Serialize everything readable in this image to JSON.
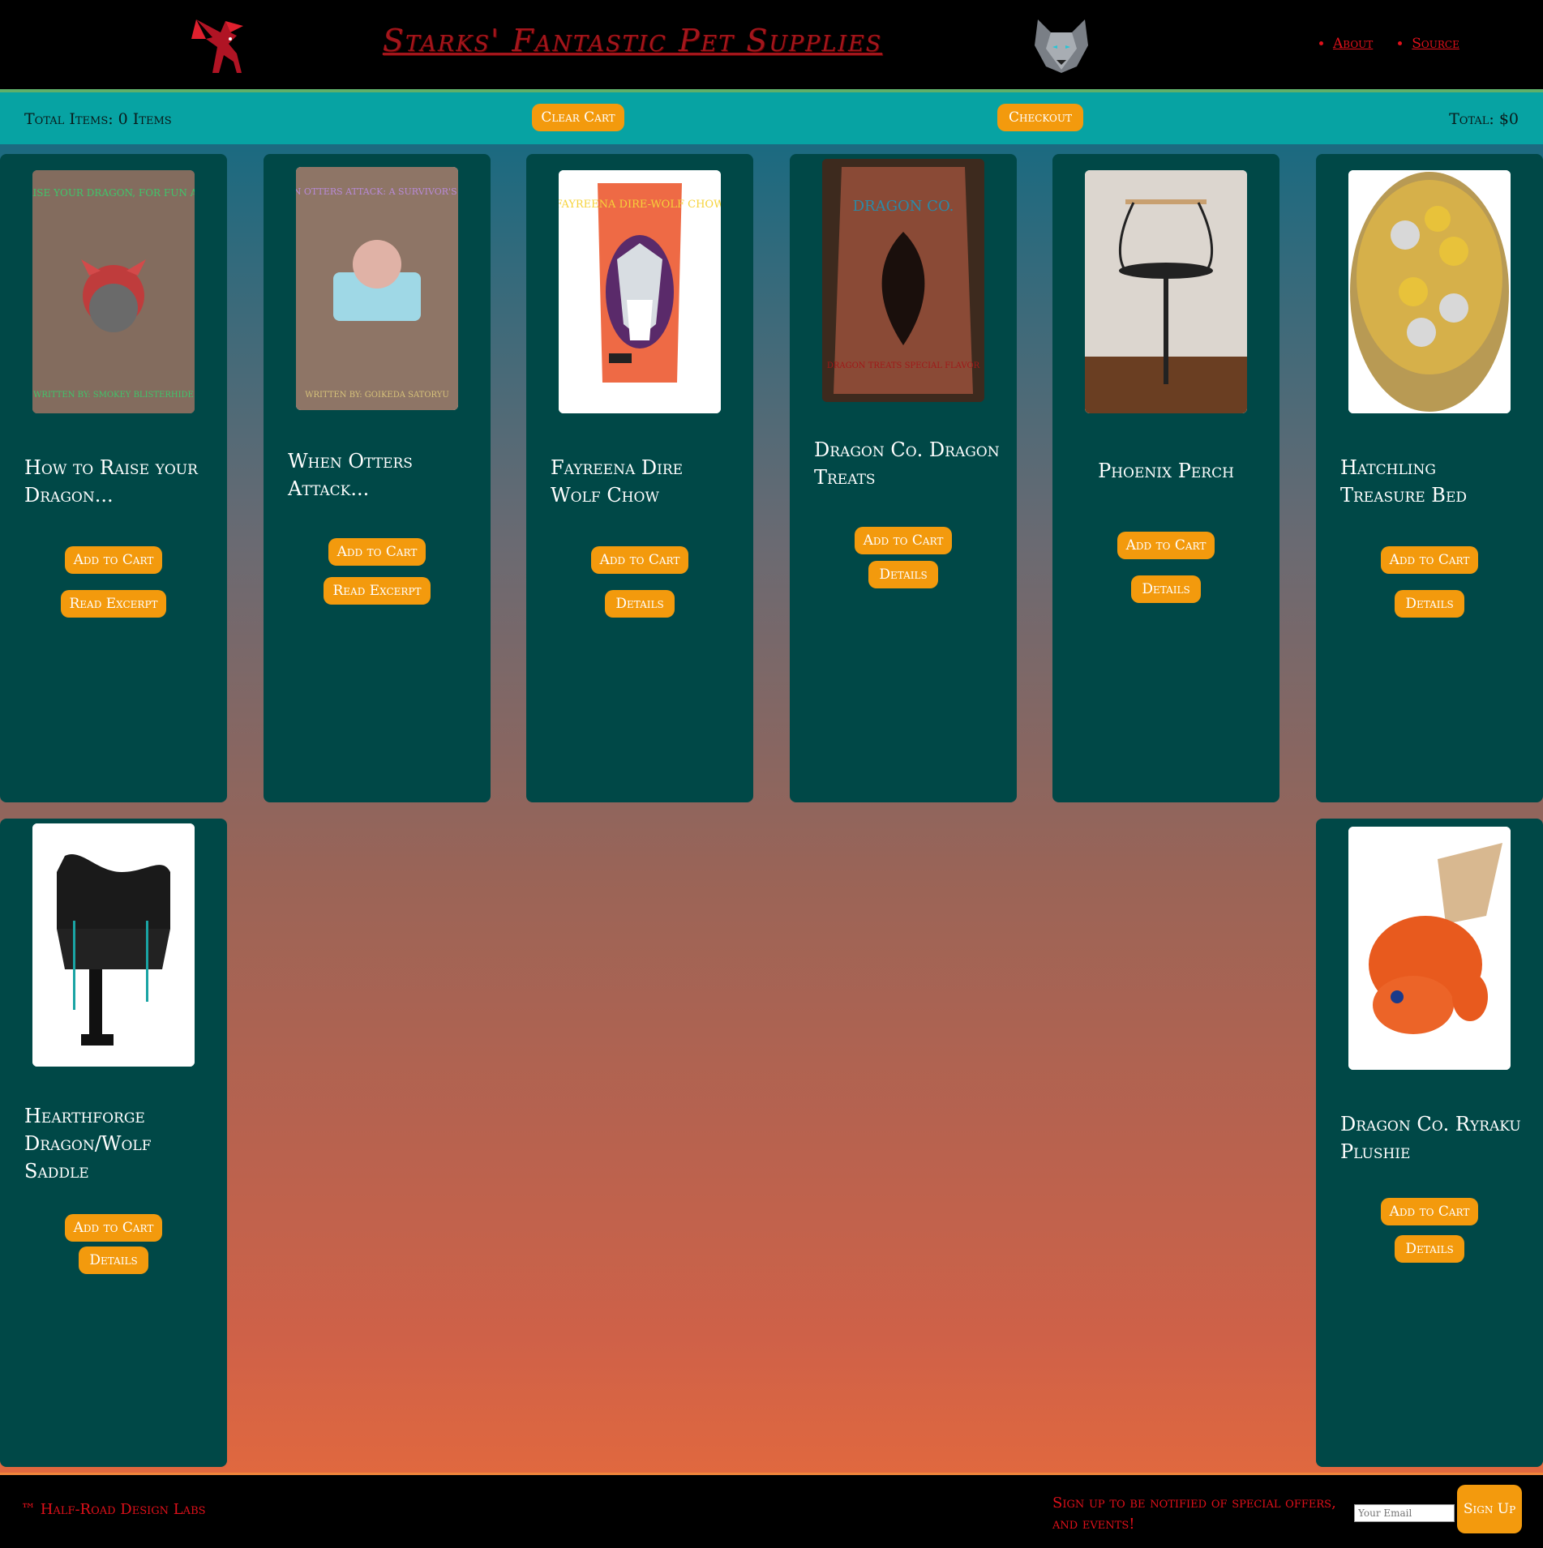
{
  "header": {
    "site_title": "Starks' Fantastic Pet Supplies",
    "nav": [
      {
        "label": "About"
      },
      {
        "label": "Source"
      }
    ]
  },
  "cart": {
    "total_items": "Total Items: 0 Items",
    "clear_label": "Clear Cart",
    "checkout_label": "Checkout",
    "total": "Total: $0"
  },
  "products": [
    {
      "title": "How to Raise your Dragon...",
      "primary": "Add to Cart",
      "secondary": "Read Excerpt",
      "cover_title": "HOW TO RAISE YOUR DRAGON, FOR FUN AND PROFIT",
      "cover_author": "WRITTEN BY: SMOKEY BLISTERHIDE"
    },
    {
      "title": "When Otters Attack...",
      "primary": "Add to Cart",
      "secondary": "Read Excerpt",
      "cover_title": "WHEN OTTERS ATTACK: A SURVIVOR'S TALE",
      "cover_author": "WRITTEN BY: GOIKEDA SATORYU"
    },
    {
      "title": "Fayreena Dire Wolf Chow",
      "primary": "Add to Cart",
      "secondary": "Details",
      "cover_title": "FAYREENA DIRE-WOLF CHOW"
    },
    {
      "title": "Dragon Co. Dragon Treats",
      "primary": "Add to Cart",
      "secondary": "Details",
      "cover_title": "DRAGON CO.",
      "cover_sub": "DRAGON TREATS SPECIAL FLAVOR"
    },
    {
      "title": "Phoenix Perch",
      "primary": "Add to Cart",
      "secondary": "Details"
    },
    {
      "title": "Hatchling Treasure Bed",
      "primary": "Add to Cart",
      "secondary": "Details"
    },
    {
      "title": "Hearthforge Dragon/Wolf Saddle",
      "primary": "Add to Cart",
      "secondary": "Details"
    },
    {
      "title": "Dragon Co. Ryraku Plushie",
      "primary": "Add to Cart",
      "secondary": "Details"
    }
  ],
  "footer": {
    "trademark": "™ Half-Road Design Labs",
    "signup_text": "Sign up to be notified of special offers, and events!",
    "email_placeholder": "Your Email",
    "signup_button": "Sign Up"
  },
  "icons": {
    "left_logo": "dragon-logo-icon",
    "right_logo": "wolf-logo-icon"
  },
  "colors": {
    "accent": "#f39a0d",
    "title_red": "#a3161c",
    "card_bg": "#004847",
    "cart_bar": "#07a3a3"
  }
}
